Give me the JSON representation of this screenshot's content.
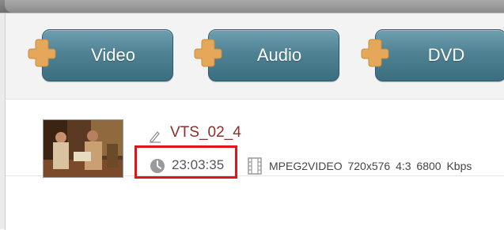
{
  "toolbar": {
    "buttons": [
      {
        "label": "Video"
      },
      {
        "label": "Audio"
      },
      {
        "label": "DVD"
      }
    ]
  },
  "file": {
    "name": "VTS_02_4",
    "duration": "23:03:35",
    "video_info": "MPEG2VIDEO  720x576  4:3  6800 Kbps"
  },
  "colors": {
    "button_top": "#6fa0b0",
    "button_bottom": "#3b6e80",
    "plus_orange": "#e5a85a",
    "title_red": "#8b2e2e",
    "highlight_red": "#e0151c"
  },
  "icons": [
    "plus-icon",
    "edit-icon",
    "clock-icon",
    "film-icon"
  ]
}
